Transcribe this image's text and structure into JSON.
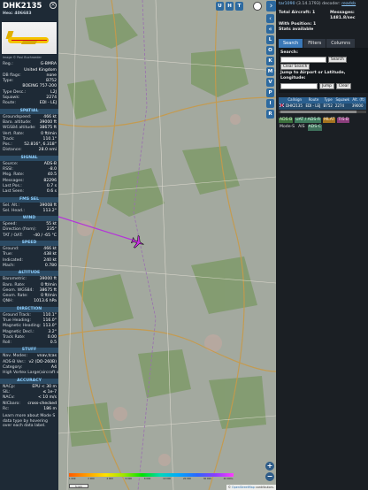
{
  "aircraft": {
    "callsign": "DHK2135",
    "hex_label": "Hex:",
    "hex": "406683",
    "photo_credit": "Image © Paul Buchroeder",
    "details": [
      {
        "k": "Reg.:",
        "v": "G-BMRA"
      },
      {
        "k": "",
        "v": "United Kingdom"
      },
      {
        "k": "DB flags:",
        "v": "none"
      },
      {
        "k": "Type:",
        "v": "B752"
      },
      {
        "k": "",
        "v": "BOEING 757-200"
      },
      {
        "k": "Type Desc.:",
        "v": "L2J"
      },
      {
        "k": "Squawk:",
        "v": "2274"
      },
      {
        "k": "Route:",
        "v": "EDI - LEJ"
      }
    ],
    "sections": [
      {
        "title": "SPATIAL",
        "rows": [
          {
            "k": "Groundspeed:",
            "v": "466 kt"
          },
          {
            "k": "Baro. altitude:",
            "v": "39000 ft"
          },
          {
            "k": "WGS84 altitude:",
            "v": "38675 ft"
          },
          {
            "k": "Vert. Rate:",
            "v": "0 ft/min"
          },
          {
            "k": "Track:",
            "v": "110.1°"
          },
          {
            "k": "Pos.:",
            "v": "52.816°, 6.318°"
          },
          {
            "k": "Distance:",
            "v": "28.0 nmi"
          }
        ]
      },
      {
        "title": "SIGNAL",
        "rows": [
          {
            "k": "Source:",
            "v": "ADS-B"
          },
          {
            "k": "RSSI:",
            "v": "-8.0"
          },
          {
            "k": "Msg. Rate:",
            "v": "40.5"
          },
          {
            "k": "Messages:",
            "v": "82296"
          },
          {
            "k": "Last Pos.:",
            "v": "0.7 s"
          },
          {
            "k": "Last Seen:",
            "v": "0.6 s"
          }
        ]
      },
      {
        "title": "FMS SEL",
        "rows": [
          {
            "k": "Sel. Alt.:",
            "v": "39008 ft"
          },
          {
            "k": "Sel. Head.:",
            "v": "113.2°"
          }
        ]
      },
      {
        "title": "WIND",
        "rows": [
          {
            "k": "Speed:",
            "v": "55 kt"
          },
          {
            "k": "Direction (from):",
            "v": "235°"
          },
          {
            "k": "TAT / OAT:",
            "v": "-40 / -65 °C"
          }
        ]
      },
      {
        "title": "SPEED",
        "rows": [
          {
            "k": "Ground:",
            "v": "466 kt"
          },
          {
            "k": "True:",
            "v": "438 kt"
          },
          {
            "k": "Indicated:",
            "v": "240 kt"
          },
          {
            "k": "Mach:",
            "v": "0.780"
          }
        ]
      },
      {
        "title": "ALTITUDE",
        "rows": [
          {
            "k": "Barometric:",
            "v": "39000 ft"
          },
          {
            "k": "Baro. Rate:",
            "v": "0 ft/min"
          },
          {
            "k": "Geom. WGS84:",
            "v": "38675 ft"
          },
          {
            "k": "Geom. Rate:",
            "v": "0 ft/min"
          },
          {
            "k": "QNH:",
            "v": "1013.6 hPa"
          }
        ]
      },
      {
        "title": "DIRECTION",
        "rows": [
          {
            "k": "Ground Track:",
            "v": "110.1°"
          },
          {
            "k": "True Heading:",
            "v": "116.0°"
          },
          {
            "k": "Magnetic Heading:",
            "v": "113.0°"
          },
          {
            "k": "Magnetic Decl.:",
            "v": "3.2°"
          },
          {
            "k": "Track Rate:",
            "v": "0.00"
          },
          {
            "k": "Roll:",
            "v": "0.5"
          }
        ]
      },
      {
        "title": "STUFF",
        "rows": [
          {
            "k": "Nav. Modes:",
            "v": "vnav,tcas"
          },
          {
            "k": "ADS-B Ver.:",
            "v": "v2 (DO-260B)"
          },
          {
            "k": "Category:",
            "v": "A4"
          },
          {
            "k": "High Vortex Large(aircraft such as B-757)",
            "v": ""
          }
        ]
      },
      {
        "title": "ACCURACY",
        "rows": [
          {
            "k": "NACp:",
            "v": "EPU < 30 m"
          },
          {
            "k": "SIL:",
            "v": "≤ 1e-7"
          },
          {
            "k": "NACv:",
            "v": "< 10 m/s"
          },
          {
            "k": "NICbaro:",
            "v": "cross-checked"
          },
          {
            "k": "Rc:",
            "v": "186 m"
          }
        ]
      }
    ],
    "footer_note": "Learn more about Mode S data type by hovering over each data label."
  },
  "map": {
    "top_buttons": [
      "U",
      "H",
      "T"
    ],
    "side_buttons": [
      "L",
      "O",
      "K",
      "M",
      "V",
      "P",
      "I",
      "R"
    ],
    "zoom_in": "+",
    "zoom_out": "−",
    "scale_label": "5 nmi",
    "alt_ticks": [
      "1 000",
      "2 000",
      "4 000",
      "6 000",
      "8 000",
      "10 000",
      "20 000",
      "30 000",
      "40 000+"
    ],
    "attribution_prefix": "©",
    "attribution_link": "OpenStreetMap",
    "attribution_suffix": "contributors.",
    "aircraft_color": "#c832e0",
    "track_color": "#b434d8"
  },
  "right_panel": {
    "version_prefix": "tar1090",
    "version": "(3.14.1793)",
    "decoder_label": "decoder:",
    "decoder_link": "readsb",
    "total_aircraft_label": "Total Aircraft:",
    "total_aircraft": "1",
    "messages_label": "Messages:",
    "messages_rate": "1481.8/sec",
    "with_position_label": "With Position:",
    "with_position": "1",
    "stats_label": "Stats available",
    "tabs": [
      "Search",
      "Filters",
      "Columns"
    ],
    "search_label": "Search:",
    "search_button": "Search",
    "clear_search_button": "Clear Search",
    "jump_label": "Jump to Airport or Latitude, Longitude:",
    "jump_button": "Jump",
    "clear_button": "Clear",
    "table_headers": [
      "",
      "Callsign",
      "Route",
      "Type",
      "Squawk",
      "Alt. (ft)"
    ],
    "table_rows": [
      {
        "callsign": "DHK2135",
        "route": "EDI - LEJ",
        "type": "B752",
        "squawk": "2274",
        "alt": "39000"
      }
    ],
    "legend": [
      "ADS-B",
      "UAT / ADS-R",
      "MLAT",
      "TIS-B",
      "Mode-S",
      "AIS",
      "ADS-C"
    ]
  }
}
